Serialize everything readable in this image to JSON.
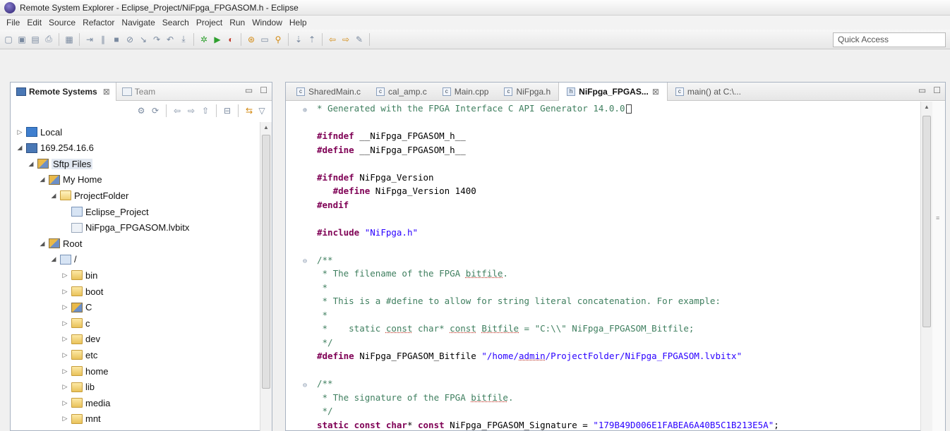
{
  "window": {
    "title": "Remote System Explorer - Eclipse_Project/NiFpga_FPGASOM.h - Eclipse"
  },
  "menu": [
    "File",
    "Edit",
    "Source",
    "Refactor",
    "Navigate",
    "Search",
    "Project",
    "Run",
    "Window",
    "Help"
  ],
  "toolbar": {
    "quick_access_placeholder": "Quick Access",
    "icons": [
      "new-icon",
      "save-icon",
      "save-all-icon",
      "print-icon",
      "build-icon",
      "step-icon",
      "suspend-icon",
      "terminate-icon",
      "disconnect-icon",
      "step-into-icon",
      "step-over-icon",
      "step-return-icon",
      "drop-frame-icon",
      "debug-icon",
      "run-icon",
      "external-tools-icon",
      "open-type-icon",
      "open-folder-icon",
      "search-icon",
      "next-annotation-icon",
      "prev-annotation-icon",
      "back-icon",
      "forward-icon",
      "pin-icon"
    ]
  },
  "left_view": {
    "tabs": [
      {
        "label": "Remote Systems",
        "active": true,
        "close": "⊠"
      },
      {
        "label": "Team",
        "active": false
      }
    ],
    "tree": [
      {
        "label": "Local",
        "level": 0,
        "expanded": false,
        "icon": "local-icon"
      },
      {
        "label": "169.254.16.6",
        "level": 0,
        "expanded": true,
        "icon": "host-icon"
      },
      {
        "label": "Sftp Files",
        "level": 1,
        "expanded": true,
        "icon": "sftp-files-icon",
        "selected": true
      },
      {
        "label": "My Home",
        "level": 2,
        "expanded": true,
        "icon": "filter-icon"
      },
      {
        "label": "ProjectFolder",
        "level": 3,
        "expanded": true,
        "icon": "folder-open-icon"
      },
      {
        "label": "Eclipse_Project",
        "level": 4,
        "icon": "project-icon"
      },
      {
        "label": "NiFpga_FPGASOM.lvbitx",
        "level": 4,
        "icon": "file-icon"
      },
      {
        "label": "Root",
        "level": 2,
        "expanded": true,
        "icon": "filter-icon"
      },
      {
        "label": "/",
        "level": 3,
        "expanded": true,
        "icon": "root-folder-icon"
      },
      {
        "label": "bin",
        "level": 4,
        "expanded": false,
        "icon": "folder-icon"
      },
      {
        "label": "boot",
        "level": 4,
        "expanded": false,
        "icon": "folder-icon"
      },
      {
        "label": "C",
        "level": 4,
        "expanded": false,
        "icon": "special-folder-icon"
      },
      {
        "label": "c",
        "level": 4,
        "expanded": false,
        "icon": "folder-icon"
      },
      {
        "label": "dev",
        "level": 4,
        "expanded": false,
        "icon": "folder-icon"
      },
      {
        "label": "etc",
        "level": 4,
        "expanded": false,
        "icon": "folder-icon"
      },
      {
        "label": "home",
        "level": 4,
        "expanded": false,
        "icon": "folder-icon"
      },
      {
        "label": "lib",
        "level": 4,
        "expanded": false,
        "icon": "folder-icon"
      },
      {
        "label": "media",
        "level": 4,
        "expanded": false,
        "icon": "folder-icon"
      },
      {
        "label": "mnt",
        "level": 4,
        "expanded": false,
        "icon": "folder-icon"
      }
    ]
  },
  "editor": {
    "tabs": [
      {
        "label": "SharedMain.c",
        "icon": "c-file-icon",
        "active": false
      },
      {
        "label": "cal_amp.c",
        "icon": "c-file-icon",
        "active": false
      },
      {
        "label": "Main.cpp",
        "icon": "c-file-icon",
        "active": false
      },
      {
        "label": "NiFpga.h",
        "icon": "c-file-icon",
        "active": false
      },
      {
        "label": "NiFpga_FPGAS...",
        "icon": "h-file-icon",
        "active": true,
        "close": "⊠"
      },
      {
        "label": "main() at C:\\...",
        "icon": "c-file-icon",
        "active": false
      }
    ],
    "lines": [
      {
        "fold": "⊕",
        "parts": [
          [
            "c-comment",
            "* Generated with the FPGA Interface C API Generator 14.0.0"
          ]
        ],
        "caret": true
      },
      {
        "parts": []
      },
      {
        "parts": [
          [
            "c-pp",
            "#ifndef"
          ],
          [
            "c-ident",
            " __NiFpga_FPGASOM_h__"
          ]
        ]
      },
      {
        "parts": [
          [
            "c-pp",
            "#define"
          ],
          [
            "c-ident",
            " __NiFpga_FPGASOM_h__"
          ]
        ]
      },
      {
        "parts": []
      },
      {
        "parts": [
          [
            "c-pp",
            "#ifndef"
          ],
          [
            "c-ident",
            " NiFpga_Version"
          ]
        ]
      },
      {
        "parts": [
          [
            "c-pp",
            "   #define"
          ],
          [
            "c-ident",
            " NiFpga_Version 1400"
          ]
        ]
      },
      {
        "parts": [
          [
            "c-pp",
            "#endif"
          ]
        ]
      },
      {
        "parts": []
      },
      {
        "parts": [
          [
            "c-pp",
            "#include"
          ],
          [
            "c-ident",
            " "
          ],
          [
            "c-str",
            "\"NiFpga.h\""
          ]
        ]
      },
      {
        "parts": []
      },
      {
        "fold": "⊖",
        "parts": [
          [
            "c-comment",
            "/**"
          ]
        ]
      },
      {
        "parts": [
          [
            "c-comment",
            " * The filename of the FPGA "
          ],
          [
            "c-comment spell",
            "bitfile"
          ],
          [
            "c-comment",
            "."
          ]
        ]
      },
      {
        "parts": [
          [
            "c-comment",
            " *"
          ]
        ]
      },
      {
        "parts": [
          [
            "c-comment",
            " * This is a #define to allow for string literal concatenation. For example:"
          ]
        ]
      },
      {
        "parts": [
          [
            "c-comment",
            " *"
          ]
        ]
      },
      {
        "parts": [
          [
            "c-comment",
            " *    static "
          ],
          [
            "c-comment spell",
            "const"
          ],
          [
            "c-comment",
            " char* "
          ],
          [
            "c-comment spell",
            "const"
          ],
          [
            "c-comment",
            " "
          ],
          [
            "c-comment spell",
            "Bitfile"
          ],
          [
            "c-comment",
            " = \"C:\\\\\" NiFpga_FPGASOM_Bitfile;"
          ]
        ]
      },
      {
        "parts": [
          [
            "c-comment",
            " */"
          ]
        ]
      },
      {
        "parts": [
          [
            "c-pp",
            "#define"
          ],
          [
            "c-ident",
            " NiFpga_FPGASOM_Bitfile "
          ],
          [
            "c-str",
            "\"/home/"
          ],
          [
            "c-str spell",
            "admin"
          ],
          [
            "c-str",
            "/ProjectFolder/NiFpga_FPGASOM.lvbitx\""
          ]
        ]
      },
      {
        "parts": []
      },
      {
        "fold": "⊖",
        "parts": [
          [
            "c-comment",
            "/**"
          ]
        ]
      },
      {
        "parts": [
          [
            "c-comment",
            " * The signature of the FPGA "
          ],
          [
            "c-comment spell",
            "bitfile"
          ],
          [
            "c-comment",
            "."
          ]
        ]
      },
      {
        "parts": [
          [
            "c-comment",
            " */"
          ]
        ]
      },
      {
        "parts": [
          [
            "c-kw",
            "static const char"
          ],
          [
            "c-ident",
            "* "
          ],
          [
            "c-kw",
            "const"
          ],
          [
            "c-ident",
            " NiFpga_FPGASOM_Signature = "
          ],
          [
            "c-str",
            "\"179B49D006E1FABEA6A40B5C1B213E5A\""
          ],
          [
            "c-ident",
            ";"
          ]
        ]
      }
    ]
  }
}
